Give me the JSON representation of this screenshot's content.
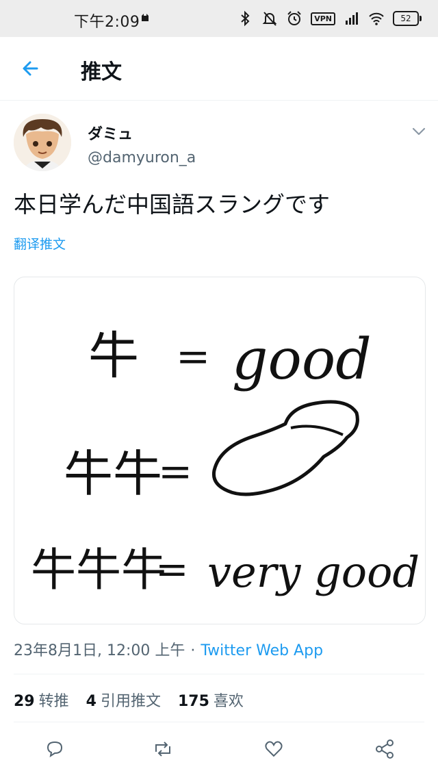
{
  "status_bar": {
    "time": "下午2:09",
    "vpn": "VPN",
    "battery": "52",
    "icons": [
      "bluetooth-icon",
      "mute-icon",
      "alarm-icon",
      "vpn-icon",
      "signal-icon",
      "wifi-icon",
      "battery-icon"
    ]
  },
  "header": {
    "title": "推文",
    "back_icon": "back-arrow-icon"
  },
  "tweet": {
    "display_name": "ダミュ",
    "handle": "@damyuron_a",
    "text": "本日学んだ中国語スラングです",
    "translate_label": "翻译推文",
    "media": {
      "line1_left": "牛",
      "line1_eq": "=",
      "line1_right": "good",
      "line2_left": "牛牛",
      "line2_eq": "=",
      "line3_left": "牛牛牛",
      "line3_eq": "=",
      "line3_right": "very good"
    },
    "timestamp": "23年8月1日, 12:00 上午",
    "separator": "·",
    "source": "Twitter Web App",
    "stats": [
      {
        "count": "29",
        "label": "转推"
      },
      {
        "count": "4",
        "label": "引用推文"
      },
      {
        "count": "175",
        "label": "喜欢"
      }
    ]
  },
  "colors": {
    "accent": "#1d9bf0",
    "secondary_text": "#536471",
    "status_bar_bg": "#ededed"
  }
}
